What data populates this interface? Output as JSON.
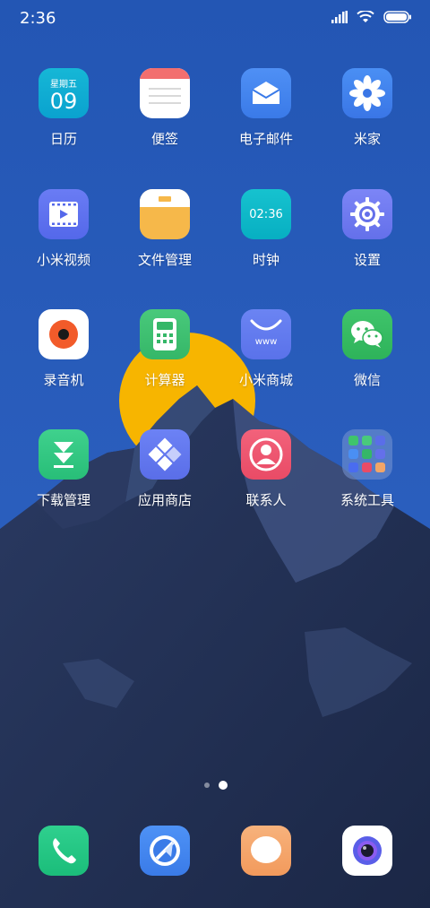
{
  "status": {
    "time": "2:36",
    "icons": [
      "signal-icon",
      "wifi-icon",
      "battery-icon"
    ]
  },
  "calendar_tile": {
    "weekday": "星期五",
    "day": "09"
  },
  "clock_tile": {
    "time": "02:36"
  },
  "mall_tile": {
    "text": "www"
  },
  "apps": [
    {
      "label": "日历",
      "icon": "calendar-icon"
    },
    {
      "label": "便签",
      "icon": "notes-icon"
    },
    {
      "label": "电子邮件",
      "icon": "email-icon"
    },
    {
      "label": "米家",
      "icon": "mijia-icon"
    },
    {
      "label": "小米视频",
      "icon": "video-icon"
    },
    {
      "label": "文件管理",
      "icon": "folder-icon"
    },
    {
      "label": "时钟",
      "icon": "clock-icon"
    },
    {
      "label": "设置",
      "icon": "settings-gear-icon"
    },
    {
      "label": "录音机",
      "icon": "recorder-icon"
    },
    {
      "label": "计算器",
      "icon": "calculator-icon"
    },
    {
      "label": "小米商城",
      "icon": "mall-icon"
    },
    {
      "label": "微信",
      "icon": "wechat-icon"
    },
    {
      "label": "下载管理",
      "icon": "download-icon"
    },
    {
      "label": "应用商店",
      "icon": "app-store-icon"
    },
    {
      "label": "联系人",
      "icon": "contacts-icon"
    },
    {
      "label": "系统工具",
      "icon": "folder-system-tools-icon"
    }
  ],
  "pages": {
    "count": 2,
    "active": 2
  },
  "dock": [
    {
      "icon": "phone-icon"
    },
    {
      "icon": "browser-icon"
    },
    {
      "icon": "messages-icon"
    },
    {
      "icon": "camera-icon"
    }
  ],
  "colors": {
    "sky_top": "#2457b6",
    "sky_bottom": "#2f62c2",
    "sun": "#f7b500",
    "mountain_dark": "#1d2a4a",
    "mountain_mid": "#34466f"
  }
}
